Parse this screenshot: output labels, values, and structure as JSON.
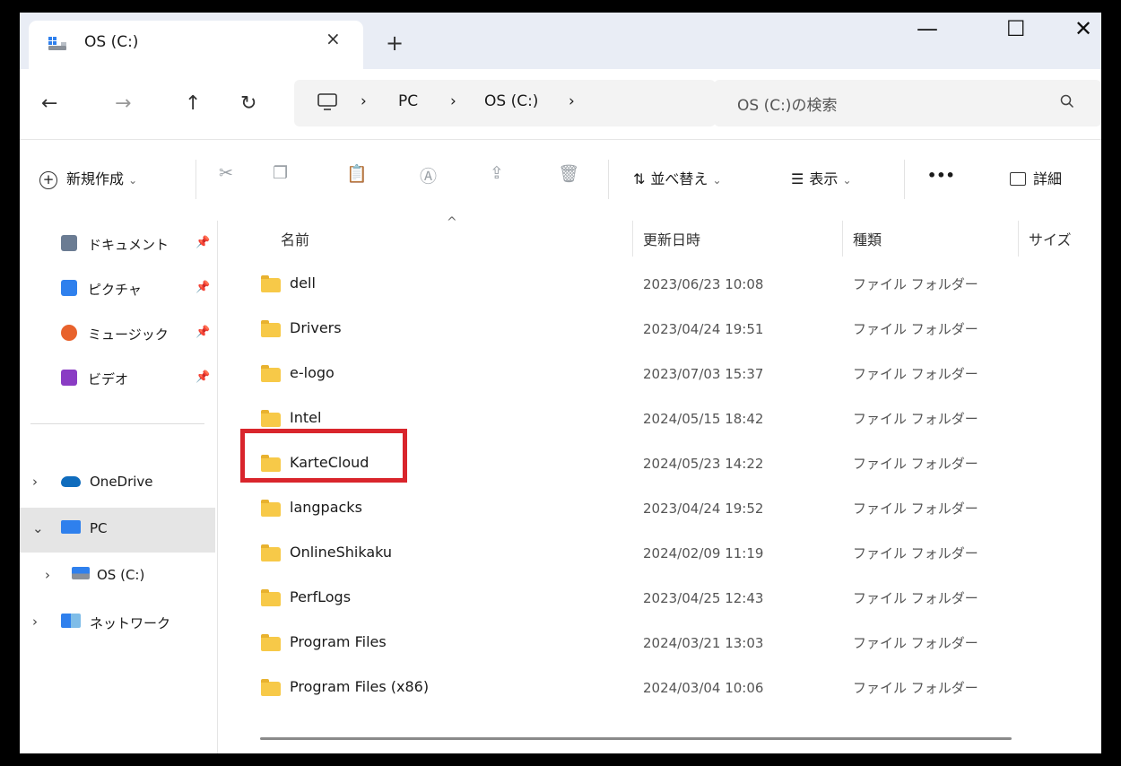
{
  "window": {
    "tab_title": "OS (C:)",
    "tab_close": "×",
    "new_tab": "+",
    "controls": {
      "minimize": "—",
      "maximize": "☐",
      "close": "✕"
    }
  },
  "nav": {
    "back": "←",
    "forward": "→",
    "up": "↑",
    "refresh": "↻",
    "breadcrumb": [
      "PC",
      "OS (C:)"
    ],
    "separator": "›",
    "search_placeholder": "OS (C:)の検索",
    "search_icon": "search-icon"
  },
  "toolbar": {
    "new": "新規作成",
    "sort": "並べ替え",
    "view": "表示",
    "more": "•••",
    "details": "詳細",
    "dropdown": "⌄"
  },
  "sidebar": {
    "quick": [
      {
        "label": "ドキュメント",
        "icon": "document-icon",
        "color": "#6b7c93"
      },
      {
        "label": "ピクチャ",
        "icon": "pictures-icon",
        "color": "#2f80ed"
      },
      {
        "label": "ミュージック",
        "icon": "music-icon",
        "color": "#e8622c"
      },
      {
        "label": "ビデオ",
        "icon": "video-icon",
        "color": "#8a3cc4"
      }
    ],
    "tree": [
      {
        "label": "OneDrive",
        "chevron": "›",
        "expanded": false
      },
      {
        "label": "PC",
        "chevron": "⌄",
        "expanded": true,
        "selected": true
      },
      {
        "label": "OS (C:)",
        "chevron": "›",
        "expanded": false,
        "child": true
      },
      {
        "label": "ネットワーク",
        "chevron": "›",
        "expanded": false
      }
    ]
  },
  "columns": {
    "name": "名前",
    "date": "更新日時",
    "type": "種類",
    "size": "サイズ"
  },
  "files": [
    {
      "name": "dell",
      "date": "2023/06/23 10:08",
      "type": "ファイル フォルダー"
    },
    {
      "name": "Drivers",
      "date": "2023/04/24 19:51",
      "type": "ファイル フォルダー"
    },
    {
      "name": "e-logo",
      "date": "2023/07/03 15:37",
      "type": "ファイル フォルダー"
    },
    {
      "name": "Intel",
      "date": "2024/05/15 18:42",
      "type": "ファイル フォルダー"
    },
    {
      "name": "KarteCloud",
      "date": "2024/05/23 14:22",
      "type": "ファイル フォルダー"
    },
    {
      "name": "langpacks",
      "date": "2023/04/24 19:52",
      "type": "ファイル フォルダー"
    },
    {
      "name": "OnlineShikaku",
      "date": "2024/02/09 11:19",
      "type": "ファイル フォルダー"
    },
    {
      "name": "PerfLogs",
      "date": "2023/04/25 12:43",
      "type": "ファイル フォルダー"
    },
    {
      "name": "Program Files",
      "date": "2024/03/21 13:03",
      "type": "ファイル フォルダー"
    },
    {
      "name": "Program Files (x86)",
      "date": "2024/03/04 10:06",
      "type": "ファイル フォルダー"
    }
  ],
  "colors": {
    "highlight": "#d9252c",
    "folder": "#f7c948",
    "selected_row": "#e5e5e5"
  }
}
